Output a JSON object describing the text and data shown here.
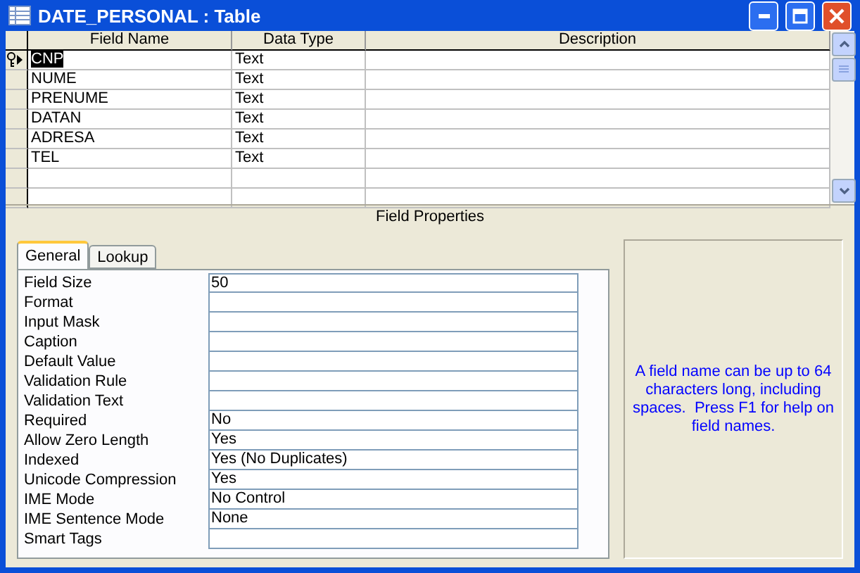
{
  "window": {
    "title": "DATE_PERSONAL : Table"
  },
  "grid": {
    "columns": [
      "Field Name",
      "Data Type",
      "Description"
    ],
    "rows": [
      {
        "field_name": "CNP",
        "data_type": "Text",
        "primary_key": true,
        "current": true
      },
      {
        "field_name": "NUME",
        "data_type": "Text",
        "primary_key": false,
        "current": false
      },
      {
        "field_name": "PRENUME",
        "data_type": "Text",
        "primary_key": false,
        "current": false
      },
      {
        "field_name": "DATAN",
        "data_type": "Text",
        "primary_key": false,
        "current": false
      },
      {
        "field_name": "ADRESA",
        "data_type": "Text",
        "primary_key": false,
        "current": false
      },
      {
        "field_name": "TEL",
        "data_type": "Text",
        "primary_key": false,
        "current": false
      }
    ]
  },
  "field_properties": {
    "title": "Field Properties",
    "tabs": [
      {
        "label": "General",
        "selected": true
      },
      {
        "label": "Lookup",
        "selected": false
      }
    ],
    "properties": [
      {
        "label": "Field Size",
        "value": "50"
      },
      {
        "label": "Format"
      },
      {
        "label": "Input Mask"
      },
      {
        "label": "Caption"
      },
      {
        "label": "Default Value"
      },
      {
        "label": "Validation Rule"
      },
      {
        "label": "Validation Text"
      },
      {
        "label": "Required",
        "value": "No"
      },
      {
        "label": "Allow Zero Length",
        "value": "Yes"
      },
      {
        "label": "Indexed",
        "value": "Yes (No Duplicates)"
      },
      {
        "label": "Unicode Compression",
        "value": "Yes"
      },
      {
        "label": "IME Mode",
        "value": "No Control"
      },
      {
        "label": "IME Sentence Mode",
        "value": "None"
      },
      {
        "label": "Smart Tags"
      }
    ],
    "help": "A field name can be up to 64 characters long, including spaces.  Press F1 for help on field names."
  }
}
